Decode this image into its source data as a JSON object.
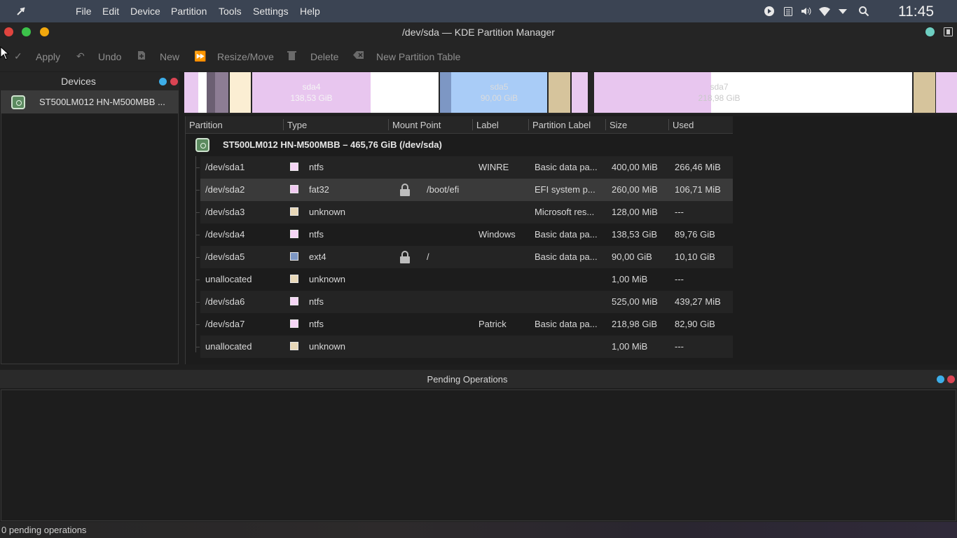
{
  "menubar": {
    "items": [
      "File",
      "Edit",
      "Device",
      "Partition",
      "Tools",
      "Settings",
      "Help"
    ],
    "clock": "11:45",
    "tray_icons": [
      "media-play-icon",
      "clipboard-icon",
      "volume-icon",
      "wifi-icon",
      "dropdown-arrow-icon",
      "search-icon"
    ]
  },
  "window": {
    "title": "/dev/sda — KDE Partition Manager"
  },
  "toolbar": {
    "apply": "Apply",
    "undo": "Undo",
    "new": "New",
    "resize_move": "Resize/Move",
    "delete": "Delete",
    "new_partition_table": "New Partition Table"
  },
  "devices": {
    "title": "Devices",
    "items": [
      {
        "label": "ST500LM012 HN-M500MBB ..."
      }
    ]
  },
  "partition_bar": {
    "segments": [
      {
        "name": "sda4",
        "size": "138,53 GiB"
      },
      {
        "name": "sda5",
        "size": "90,00 GiB"
      },
      {
        "name": "sda7",
        "size": "218,98 GiB"
      }
    ]
  },
  "table": {
    "headers": [
      "Partition",
      "Type",
      "Mount Point",
      "Label",
      "Partition Label",
      "Size",
      "Used"
    ],
    "device_row": "ST500LM012 HN-M500MBB – 465,76 GiB (/dev/sda)",
    "rows": [
      {
        "partition": "/dev/sda1",
        "type": "ntfs",
        "color": "#f5d5f5",
        "locked": false,
        "mount": "",
        "label": "WINRE",
        "plabel": "Basic data pa...",
        "size": "400,00 MiB",
        "used": "266,46 MiB"
      },
      {
        "partition": "/dev/sda2",
        "type": "fat32",
        "color": "#f0c8f0",
        "locked": true,
        "mount": "/boot/efi",
        "label": "",
        "plabel": "EFI system p...",
        "size": "260,00 MiB",
        "used": "106,71 MiB"
      },
      {
        "partition": "/dev/sda3",
        "type": "unknown",
        "color": "#e8d8b8",
        "locked": false,
        "mount": "",
        "label": "",
        "plabel": "Microsoft res...",
        "size": "128,00 MiB",
        "used": "---"
      },
      {
        "partition": "/dev/sda4",
        "type": "ntfs",
        "color": "#f5d5f5",
        "locked": false,
        "mount": "",
        "label": "Windows",
        "plabel": "Basic data pa...",
        "size": "138,53 GiB",
        "used": "89,76 GiB"
      },
      {
        "partition": "/dev/sda5",
        "type": "ext4",
        "color": "#7d97c4",
        "locked": true,
        "mount": "/",
        "label": "",
        "plabel": "Basic data pa...",
        "size": "90,00 GiB",
        "used": "10,10 GiB"
      },
      {
        "partition": "unallocated",
        "type": "unknown",
        "color": "#e8d8b8",
        "locked": false,
        "mount": "",
        "label": "",
        "plabel": "",
        "size": "1,00 MiB",
        "used": "---"
      },
      {
        "partition": "/dev/sda6",
        "type": "ntfs",
        "color": "#f5d5f5",
        "locked": false,
        "mount": "",
        "label": "",
        "plabel": "",
        "size": "525,00 MiB",
        "used": "439,27 MiB"
      },
      {
        "partition": "/dev/sda7",
        "type": "ntfs",
        "color": "#f5d5f5",
        "locked": false,
        "mount": "",
        "label": "Patrick",
        "plabel": "Basic data pa...",
        "size": "218,98 GiB",
        "used": "82,90 GiB"
      },
      {
        "partition": "unallocated",
        "type": "unknown",
        "color": "#e8d8b8",
        "locked": false,
        "mount": "",
        "label": "",
        "plabel": "",
        "size": "1,00 MiB",
        "used": "---"
      }
    ]
  },
  "pending": {
    "title": "Pending Operations",
    "status": "0 pending operations"
  },
  "colors": {
    "ntfs": "#e6c8ef",
    "ext4": "#a9c8f2",
    "unknown": "#d6c49c",
    "selection": "#3a3a3a",
    "accent_blue": "#3daee9",
    "close_red": "#da4453"
  }
}
